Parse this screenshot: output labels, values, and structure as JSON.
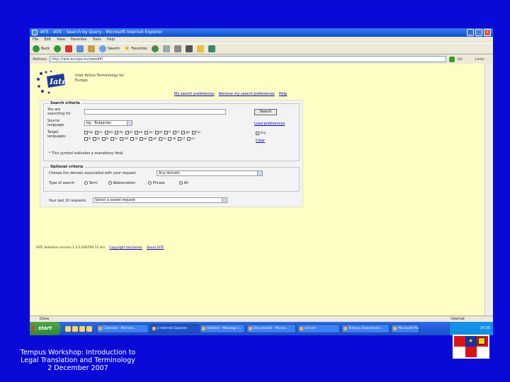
{
  "window": {
    "title": "IATE - IATE : Search by Query - Microsoft Internet Explorer",
    "buttons": [
      "_",
      "□",
      "x"
    ]
  },
  "menu": [
    "File",
    "Edit",
    "View",
    "Favorites",
    "Tools",
    "Help"
  ],
  "toolbar": {
    "back": "Back",
    "search": "Search",
    "favorites": "Favorites"
  },
  "address": {
    "label": "Address",
    "url": "http://iate.europa.eu/iatediff/",
    "go": "Go",
    "links": "Links"
  },
  "iate": {
    "tagline": "Inter Active Terminology for Europe",
    "links": [
      "My search preferences",
      "Remove my search preferences",
      "Help"
    ],
    "search_legend": "Search criteria",
    "searching_label": "You are searching for",
    "search_button": "Search",
    "source_label": "Source language",
    "source_value": "bg - Bulgarian",
    "load_prefs": "Load preferences",
    "target_label": "Target languages",
    "target_row1": [
      "bg",
      "cs",
      "da",
      "de",
      "el",
      "en",
      "es",
      "et",
      "fi",
      "fr",
      "ga",
      "hu"
    ],
    "target_row2": [
      "it",
      "la",
      "lt",
      "lv",
      "mt",
      "nl",
      "pl",
      "pt",
      "ro",
      "sk",
      "sl",
      "sv"
    ],
    "any_label": "Any",
    "clear_label": "Clear",
    "mandatory_note": "* This symbol indicates a mandatory field.",
    "optional_legend": "Optional criteria",
    "domain_label": "Choose the domain associated with your request",
    "domain_value": "Any domain",
    "type_label": "Type of search",
    "type_options": [
      "Term",
      "Abbreviation",
      "Phrase",
      "All"
    ],
    "last_label": "Your last 10 requests",
    "last_value": "Select a saved request",
    "footer": [
      "IATE Selection version 1.2.0.200709 11 Hrs",
      "Copyright disclaimer",
      "About IATE"
    ]
  },
  "status": {
    "left": "Done",
    "zone": "Internet"
  },
  "taskbar": {
    "start": "start",
    "tasks": [
      "Calendar - Microso...",
      "2 Internet Explorer",
      "Untitled - Message (...",
      "Document3 - Micros...",
      "served",
      "Tempus Dokumente...",
      "Microsoft PowerPoint..."
    ],
    "clock": "14:30"
  },
  "caption": [
    "Tempus Workshop: Introduction to",
    "Legal Translation and Terminology",
    "2 December 2007"
  ]
}
